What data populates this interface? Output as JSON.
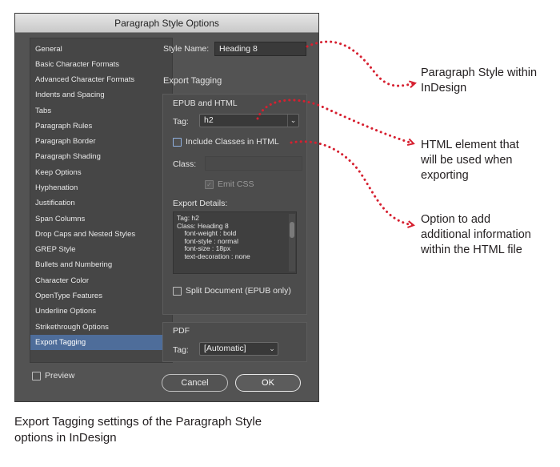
{
  "dialog": {
    "title": "Paragraph Style Options",
    "categories": [
      "General",
      "Basic Character Formats",
      "Advanced Character Formats",
      "Indents and Spacing",
      "Tabs",
      "Paragraph Rules",
      "Paragraph Border",
      "Paragraph Shading",
      "Keep Options",
      "Hyphenation",
      "Justification",
      "Span Columns",
      "Drop Caps and Nested Styles",
      "GREP Style",
      "Bullets and Numbering",
      "Character Color",
      "OpenType Features",
      "Underline Options",
      "Strikethrough Options",
      "Export Tagging"
    ],
    "selected_category": "Export Tagging",
    "preview_label": "Preview",
    "style_name_label": "Style Name:",
    "style_name_value": "Heading 8",
    "section_title": "Export Tagging",
    "epub": {
      "group_title": "EPUB and HTML",
      "tag_label": "Tag:",
      "tag_value": "h2",
      "include_classes_label": "Include Classes in HTML",
      "class_label": "Class:",
      "class_value": "",
      "emit_css_label": "Emit CSS",
      "details_label": "Export Details:",
      "details_lines": [
        "Tag: h2",
        "Class: Heading 8",
        "    font-weight : bold",
        "    font-style : normal",
        "    font-size : 18px",
        "    text-decoration : none"
      ],
      "split_label": "Split Document (EPUB only)"
    },
    "pdf": {
      "group_title": "PDF",
      "tag_label": "Tag:",
      "tag_value": "[Automatic]"
    },
    "buttons": {
      "cancel": "Cancel",
      "ok": "OK"
    }
  },
  "annotations": {
    "style_within": [
      "Paragraph Style within",
      "InDesign"
    ],
    "html_element": [
      "HTML element that",
      "will be used when",
      "exporting"
    ],
    "option_add": [
      "Option to add",
      "additional information",
      "within the HTML file"
    ]
  },
  "caption": [
    "Export Tagging settings of the Paragraph Style",
    "options in InDesign"
  ],
  "colors": {
    "arrow": "#d62030",
    "dialog_bg": "#535353",
    "selection": "#4e6d9a"
  }
}
